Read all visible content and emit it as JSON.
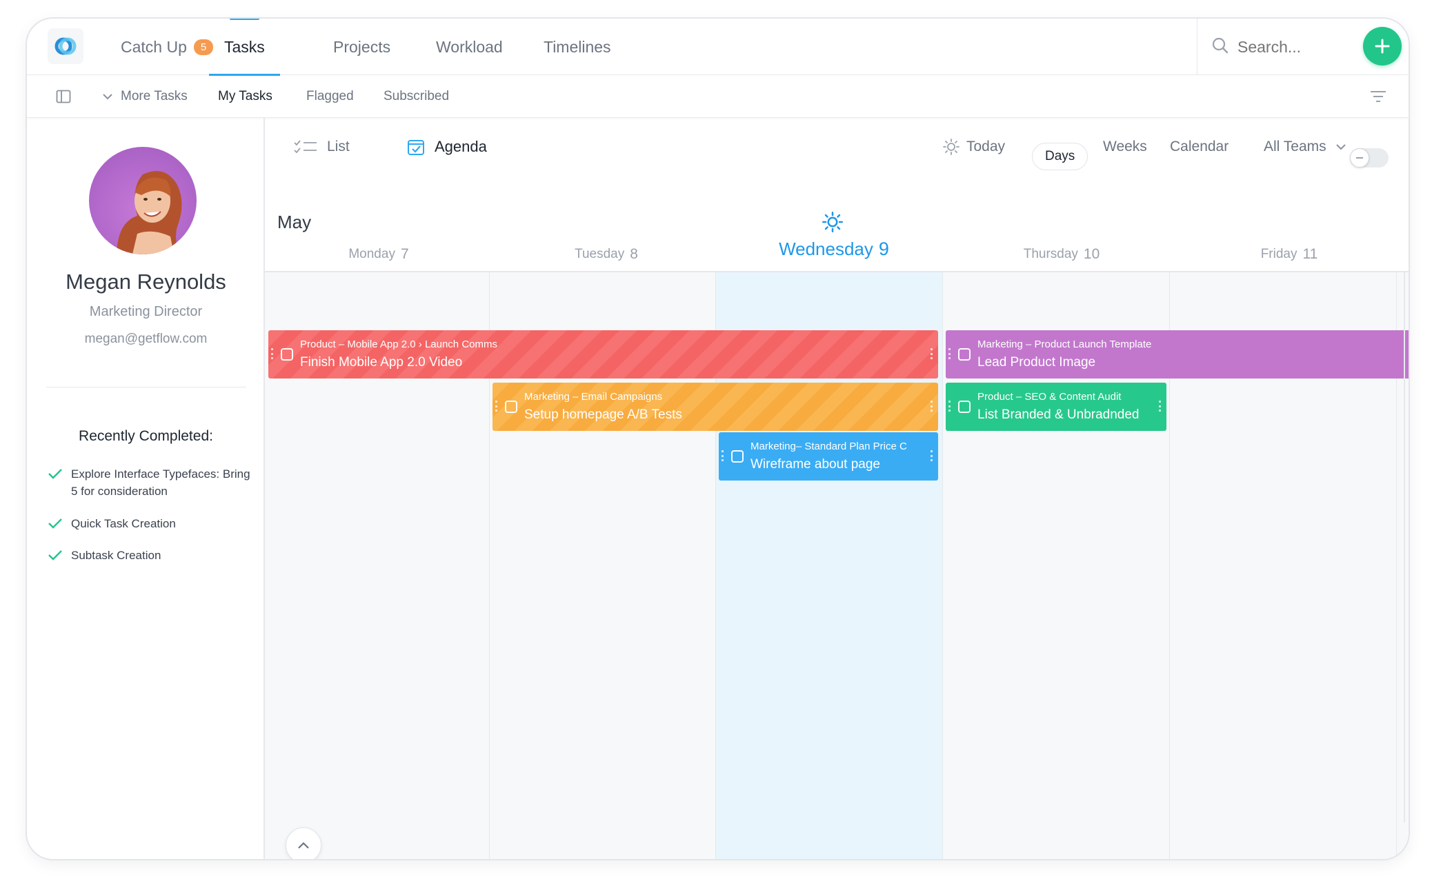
{
  "nav": {
    "items": [
      {
        "label": "Catch Up",
        "badge": "5"
      },
      {
        "label": "Tasks"
      },
      {
        "label": "Projects"
      },
      {
        "label": "Workload"
      },
      {
        "label": "Timelines"
      }
    ],
    "search_placeholder": "Search...",
    "accent": "#2ea7ef"
  },
  "subnav": {
    "more_tasks": "More Tasks",
    "items": [
      "My Tasks",
      "Flagged",
      "Subscribed"
    ]
  },
  "profile": {
    "name": "Megan Reynolds",
    "role": "Marketing Director",
    "email": "megan@getflow.com",
    "recent_title": "Recently Completed:",
    "recent": [
      "Explore Interface Typefaces: Bring 5 for consideration",
      "Quick Task Creation",
      "Subtask Creation"
    ]
  },
  "toolbar": {
    "list": "List",
    "agenda": "Agenda",
    "today": "Today",
    "days": "Days",
    "weeks": "Weeks",
    "calendar": "Calendar",
    "teams": "All Teams"
  },
  "calendar": {
    "month": "May",
    "days": [
      {
        "name": "Monday",
        "num": "7"
      },
      {
        "name": "Tuesday",
        "num": "8"
      },
      {
        "name": "Wednesday",
        "num": "9"
      },
      {
        "name": "Thursday",
        "num": "10"
      },
      {
        "name": "Friday",
        "num": "11"
      }
    ]
  },
  "tasks": [
    {
      "project": "Product – Mobile App 2.0 › Launch Comms",
      "title": "Finish Mobile App 2.0 Video",
      "color": "#f46464"
    },
    {
      "project": "Marketing –  Email Campaigns",
      "title": "Setup homepage A/B Tests",
      "color": "#f8ab3e"
    },
    {
      "project": "Marketing– Standard Plan Price C",
      "title": "Wireframe about page",
      "color": "#3aacf3"
    },
    {
      "project": "Marketing – Product Launch Template",
      "title": "Lead Product Image",
      "color": "#c277cd"
    },
    {
      "project": "Product – SEO & Content Audit",
      "title": "List Branded & Unbradnded",
      "color": "#27c88c"
    }
  ]
}
